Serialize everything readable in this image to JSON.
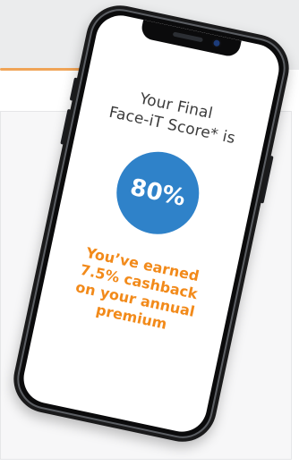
{
  "screen": {
    "headline_line1": "Your Final",
    "headline_line2": "Face-iT Score* is",
    "score": "80%",
    "cashback_line1": "You’ve earned",
    "cashback_line2": "7.5% cashback",
    "cashback_line3": "on your annual",
    "cashback_line4": "premium"
  },
  "colors": {
    "score_circle": "#2f82c9",
    "cashback_text": "#f28a1a",
    "accent_line": "#f0a457",
    "phone_frame": "#1a1a1b"
  }
}
